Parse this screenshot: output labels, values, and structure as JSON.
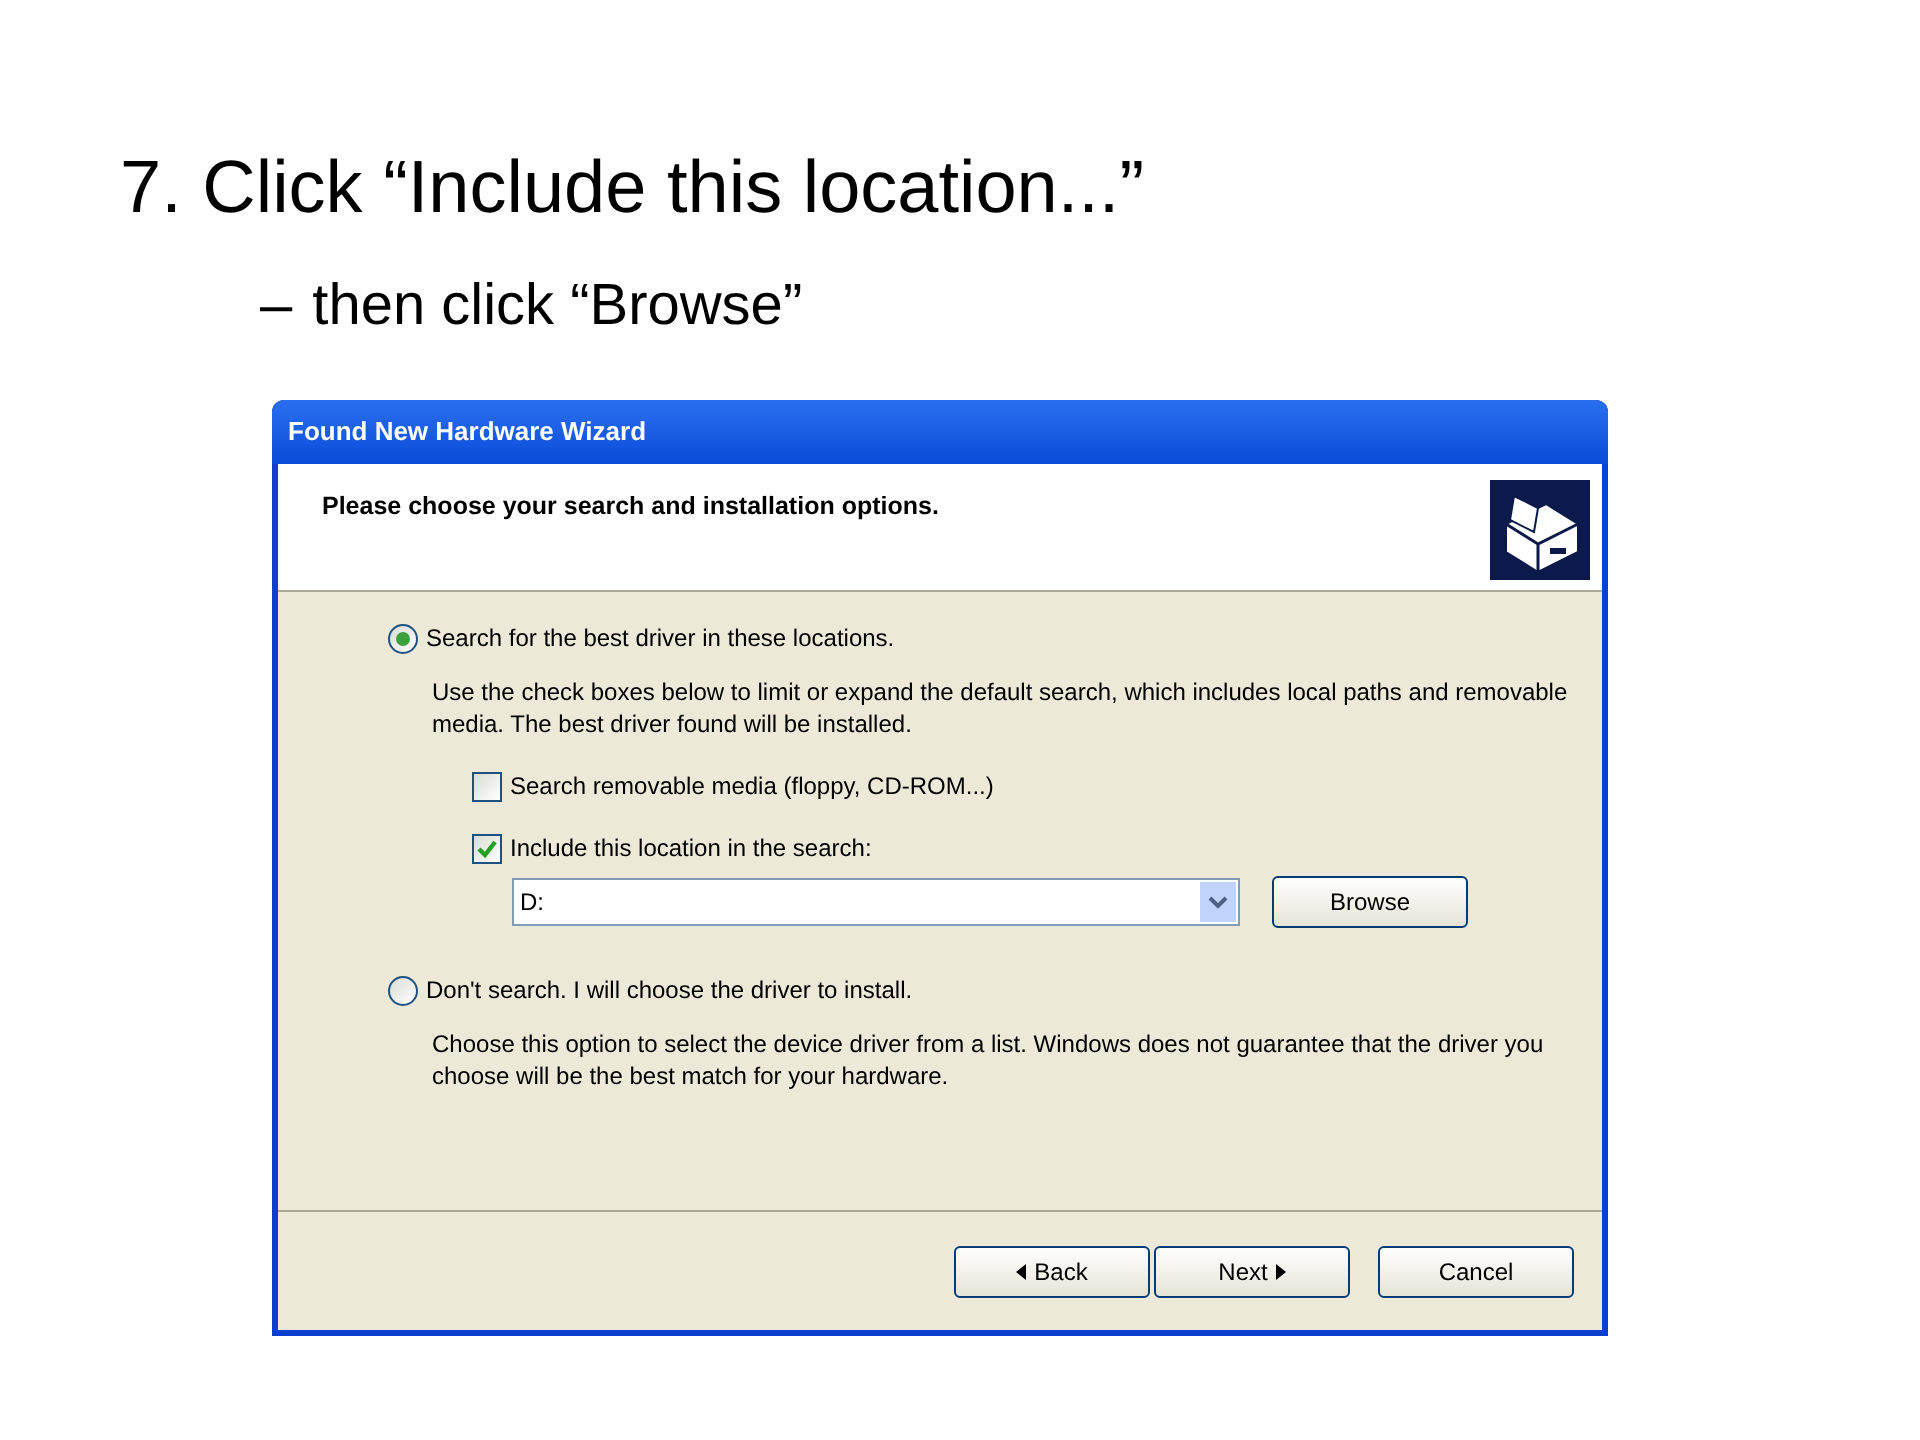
{
  "slide": {
    "heading": "7. Click “Include this location...”",
    "bullet": {
      "dash": "–",
      "text": "then click “Browse”"
    }
  },
  "window": {
    "title": "Found New Hardware Wizard",
    "header": "Please choose your search and installation options.",
    "options": [
      {
        "label": "Search for the best driver in these locations.",
        "selected": true,
        "description": "Use the check boxes below to limit or expand the default search, which includes local paths and removable media. The best driver found will be installed.",
        "checkboxes": [
          {
            "label": "Search removable media (floppy, CD-ROM...)",
            "checked": false
          },
          {
            "label": "Include this location in the search:",
            "checked": true
          }
        ],
        "location": {
          "value": "D:"
        },
        "browse": "Browse"
      },
      {
        "label": "Don't search. I will choose the driver to install.",
        "selected": false,
        "description": "Choose this option to select the device driver from a list.  Windows does not guarantee that the driver you choose will be the best match for your hardware."
      }
    ],
    "buttons": [
      {
        "label": "Back",
        "kind": "back"
      },
      {
        "label": "Next",
        "kind": "next"
      },
      {
        "label": "Cancel",
        "kind": "plain"
      }
    ]
  }
}
